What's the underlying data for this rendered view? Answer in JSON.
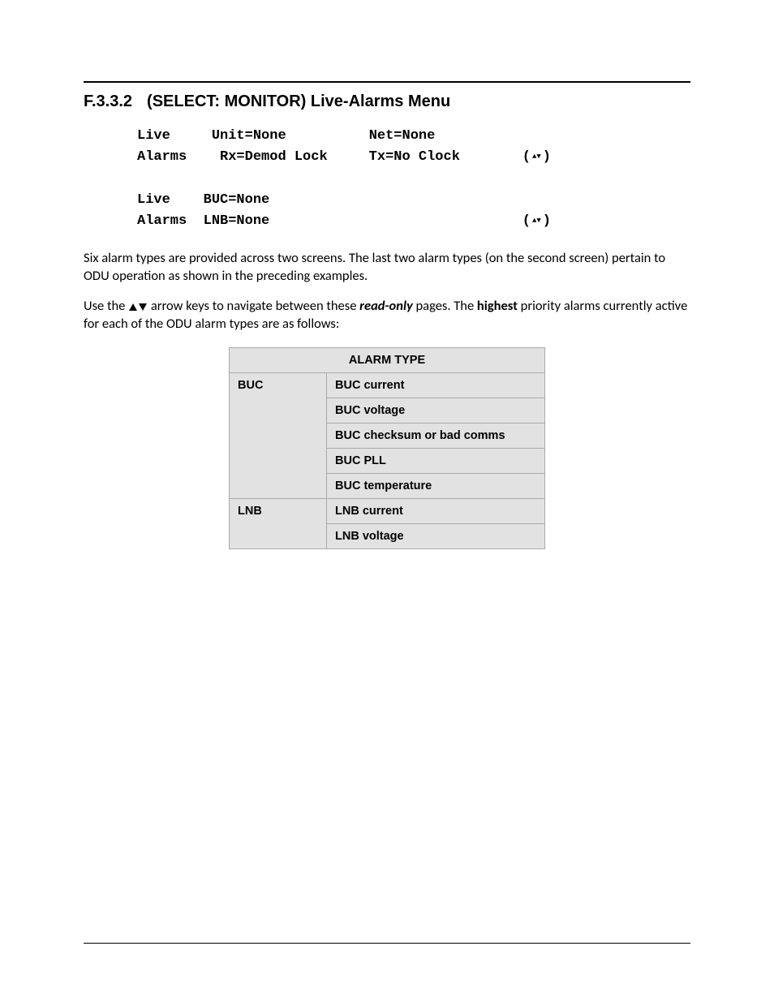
{
  "section": {
    "number": "F.3.3.2",
    "title": "(SELECT: MONITOR) Live-Alarms Menu"
  },
  "lcd": {
    "screen1": {
      "line1_col1": "Live",
      "line1_col2": "Unit=None",
      "line1_col3": "Net=None",
      "line2_col1": "Alarms",
      "line2_col2": " Rx=Demod Lock",
      "line2_col3": "Tx=No Clock"
    },
    "screen2": {
      "line1_col1": "Live",
      "line1_col2": "BUC=None",
      "line2_col1": "Alarms",
      "line2_col2": "LNB=None"
    }
  },
  "paragraphs": {
    "p1": "Six alarm types are provided across two screens. The last two alarm types (on the second screen) pertain to ODU operation as shown in the preceding examples.",
    "p2_pre": "Use the ",
    "p2_mid": " arrow keys to navigate between these ",
    "p2_readonly": "read-only",
    "p2_after": " pages. The ",
    "p2_highest": "highest",
    "p2_end": " priority alarms currently active for each of the ODU alarm types are as follows:"
  },
  "table": {
    "header": "ALARM TYPE",
    "rows": [
      {
        "category": "BUC",
        "items": [
          "BUC current",
          "BUC voltage",
          "BUC checksum or bad comms",
          "BUC PLL",
          "BUC temperature"
        ]
      },
      {
        "category": "LNB",
        "items": [
          "LNB current",
          "LNB voltage"
        ]
      }
    ]
  }
}
